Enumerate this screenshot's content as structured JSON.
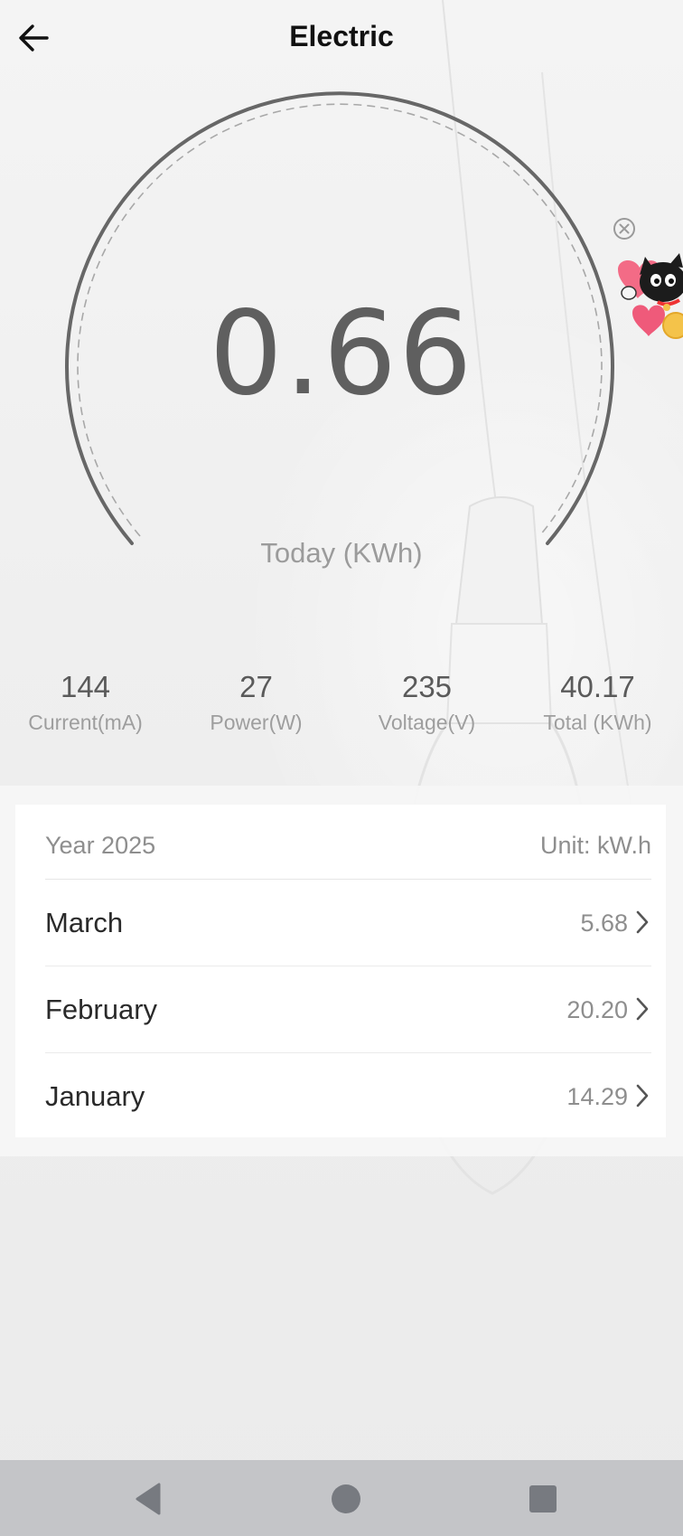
{
  "header": {
    "title": "Electric",
    "back_icon": "arrow-left-icon"
  },
  "gauge": {
    "value": "0.66",
    "label": "Today (KWh)"
  },
  "ad": {
    "close_icon": "close-circle-icon",
    "image_icon": "lucky-cat-hearts-icon"
  },
  "stats": [
    {
      "value": "144",
      "label": "Current(mA)"
    },
    {
      "value": "27",
      "label": "Power(W)"
    },
    {
      "value": "235",
      "label": "Voltage(V)"
    },
    {
      "value": "40.17",
      "label": "Total (KWh)"
    }
  ],
  "history": {
    "year_label": "Year 2025",
    "unit_label": "Unit: kW.h",
    "months": [
      {
        "name": "March",
        "value": "5.68"
      },
      {
        "name": "February",
        "value": "20.20"
      },
      {
        "name": "January",
        "value": "14.29"
      }
    ],
    "row_icon": "chevron-right-icon"
  },
  "navbar": {
    "back_icon": "nav-back-triangle-icon",
    "home_icon": "nav-home-circle-icon",
    "recents_icon": "nav-recents-square-icon"
  },
  "colors": {
    "gauge_arc": "#666666",
    "value_text": "#5f5f5f",
    "muted_text": "#9b9b9b",
    "navbar_bg": "#c4c5c8"
  }
}
